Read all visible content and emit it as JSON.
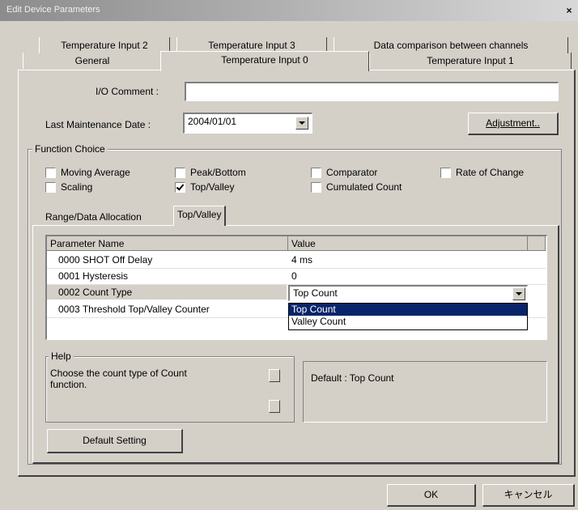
{
  "window": {
    "title": "Edit Device Parameters",
    "close_symbol": "×"
  },
  "tabs": {
    "row1": [
      "Temperature Input 2",
      "Temperature Input 3",
      "Data comparison between channels"
    ],
    "row2": [
      "General",
      "Temperature Input 0",
      "Temperature Input 1"
    ],
    "active": "Temperature Input 0"
  },
  "io_comment": {
    "label": "I/O Comment :",
    "value": ""
  },
  "maintenance": {
    "label": "Last Maintenance Date :",
    "value": "2004/01/01"
  },
  "adjustment_button": "Adjustment..",
  "function_choice": {
    "title": "Function Choice",
    "options": [
      {
        "label": "Moving Average",
        "checked": false
      },
      {
        "label": "Peak/Bottom",
        "checked": false
      },
      {
        "label": "Comparator",
        "checked": false
      },
      {
        "label": "Rate of Change",
        "checked": false
      },
      {
        "label": "Scaling",
        "checked": false
      },
      {
        "label": "Top/Valley",
        "checked": true
      },
      {
        "label": "Cumulated Count",
        "checked": false
      }
    ]
  },
  "subtabs": [
    "Range/Data Allocation",
    "Top/Valley"
  ],
  "parameter_table": {
    "headers": [
      "Parameter Name",
      "Value"
    ],
    "rows": [
      {
        "name": "0000 SHOT Off Delay",
        "value": "4 ms"
      },
      {
        "name": "0001 Hysteresis",
        "value": "0"
      },
      {
        "name": "0002 Count Type",
        "value": "Top Count"
      },
      {
        "name": "0003 Threshold Top/Valley Counter",
        "value": ""
      }
    ],
    "dropdown_options": [
      "Top Count",
      "Valley Count"
    ],
    "selected_option": "Top Count"
  },
  "help": {
    "title": "Help",
    "text": "Choose the count type of Count function.",
    "default_text": "Default : Top Count"
  },
  "default_setting_button": "Default Setting",
  "footer": {
    "ok": "OK",
    "cancel": "キャンセル"
  },
  "colors": {
    "selection": "#0a246a",
    "face": "#d4d0c8"
  }
}
